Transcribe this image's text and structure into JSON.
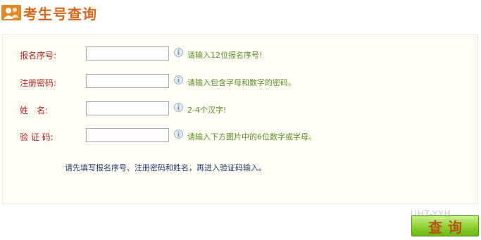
{
  "header": {
    "title": "考生号查询",
    "icon": "user-group-icon"
  },
  "form": {
    "fields": [
      {
        "label": "报名序号:",
        "value": "",
        "hint": "请输入12位报名序号!"
      },
      {
        "label": "注册密码:",
        "value": "",
        "hint": "请输入包含字母和数字的密码。"
      },
      {
        "label": "姓　名:",
        "value": "",
        "hint": "2-4个汉字!"
      },
      {
        "label": "验 证 码:",
        "value": "",
        "hint": "请输入下方图片中的6位数字或字母。"
      }
    ],
    "instruction": "请先填写报名序号、注册密码和姓名，再进入验证码输入。"
  },
  "actions": {
    "query_label": "查询",
    "partial_text": "UHT-YYH"
  },
  "colors": {
    "title": "#d2691e",
    "label": "#b22222",
    "hint": "#5b8c2a",
    "instruction": "#1e3c6e",
    "button_top": "#c9f08c",
    "button_bottom": "#6cb515"
  }
}
